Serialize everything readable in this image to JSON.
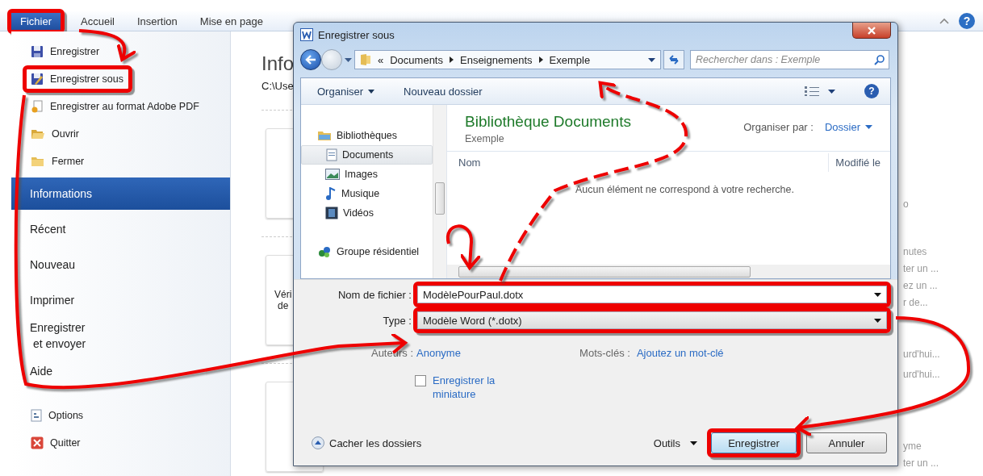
{
  "ribbon": {
    "file_tab": {
      "label": "Fichier",
      "highlighted": true
    },
    "tabs": [
      "Accueil",
      "Insertion",
      "Mise en page"
    ],
    "help": "?"
  },
  "backstage": {
    "items": [
      {
        "kind": "command",
        "label": "Enregistrer",
        "selected": false,
        "highlighted": false
      },
      {
        "kind": "command",
        "label": "Enregistrer sous",
        "selected": false,
        "highlighted": true
      },
      {
        "kind": "command",
        "label": "Enregistrer au format Adobe PDF",
        "selected": false,
        "highlighted": false
      },
      {
        "kind": "command",
        "label": "Ouvrir",
        "selected": false,
        "highlighted": false
      },
      {
        "kind": "command",
        "label": "Fermer",
        "selected": false,
        "highlighted": false
      },
      {
        "kind": "section",
        "label": "Informations",
        "selected": true,
        "highlighted": false
      },
      {
        "kind": "section",
        "label": "Récent",
        "selected": false,
        "highlighted": false
      },
      {
        "kind": "section",
        "label": "Nouveau",
        "selected": false,
        "highlighted": false
      },
      {
        "kind": "section",
        "label": "Imprimer",
        "selected": false,
        "highlighted": false
      },
      {
        "kind": "section",
        "label": "Enregistrer\n et envoyer",
        "selected": false,
        "highlighted": false
      },
      {
        "kind": "section",
        "label": "Aide",
        "selected": false,
        "highlighted": false
      },
      {
        "kind": "command",
        "label": "Options",
        "selected": false,
        "highlighted": false
      },
      {
        "kind": "command",
        "label": "Quitter",
        "selected": false,
        "highlighted": false
      }
    ]
  },
  "info_pane": {
    "title": "Info",
    "path": "C:\\Use",
    "card_lines": [
      "Véri",
      "de"
    ],
    "right_column": [
      [
        "o"
      ],
      [
        "nutes",
        "ter un ...",
        "ez un ...",
        "r de..."
      ],
      [
        "urd'hui...",
        "urd'hui..."
      ],
      [
        "yme",
        "ter un ..."
      ]
    ]
  },
  "dialog": {
    "title": "Enregistrer sous",
    "breadcrumb_prefix": "«",
    "breadcrumb": [
      "Documents",
      "Enseignements",
      "Exemple"
    ],
    "search": {
      "placeholder": "Rechercher dans : Exemple"
    },
    "toolbar": [
      "Organiser",
      "Nouveau dossier"
    ],
    "help": "?",
    "nav": [
      {
        "label": "Bibliothèques",
        "selected": false,
        "children": [
          {
            "label": "Documents",
            "selected": true
          },
          {
            "label": "Images",
            "selected": false
          },
          {
            "label": "Musique",
            "selected": false
          },
          {
            "label": "Vidéos",
            "selected": false
          }
        ]
      },
      {
        "label": "Groupe résidentiel",
        "selected": false
      }
    ],
    "library_title": "Bibliothèque Documents",
    "library_subtitle": "Exemple",
    "arrange_label": "Organiser par :",
    "arrange_value": "Dossier",
    "columns": [
      "Nom",
      "Modifié le"
    ],
    "empty_message": "Aucun élément ne correspond à votre recherche.",
    "filename_label": "Nom de fichier :",
    "filename": "ModèlePourPaul.dotx",
    "filename_highlighted": true,
    "type_label": "Type :",
    "type": "Modèle Word (*.dotx)",
    "type_highlighted": true,
    "authors_label": "Auteurs :",
    "authors": "Anonyme",
    "keywords_label": "Mots-clés :",
    "keywords": "Ajoutez un mot-clé",
    "thumbnail": {
      "label": "Enregistrer la miniature",
      "checked": false
    },
    "hide_folders": "Cacher les dossiers",
    "tools": "Outils",
    "buttons": [
      {
        "label": "Enregistrer",
        "highlighted": true
      },
      {
        "label": "Annuler",
        "highlighted": false
      }
    ]
  }
}
